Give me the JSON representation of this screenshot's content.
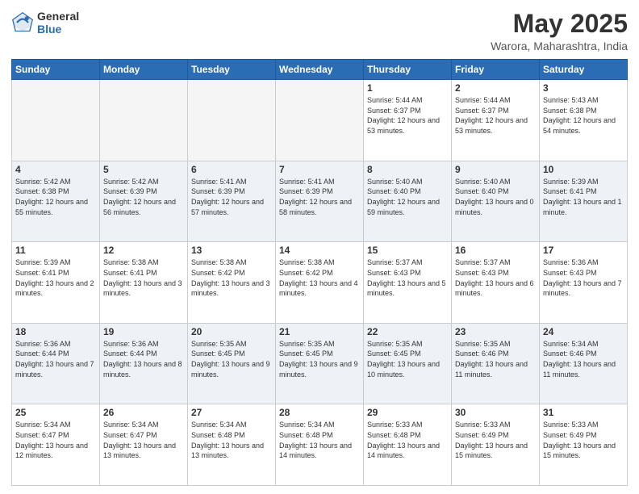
{
  "header": {
    "logo_general": "General",
    "logo_blue": "Blue",
    "month_title": "May 2025",
    "location": "Warora, Maharashtra, India"
  },
  "days_of_week": [
    "Sunday",
    "Monday",
    "Tuesday",
    "Wednesday",
    "Thursday",
    "Friday",
    "Saturday"
  ],
  "weeks": [
    [
      {
        "day": "",
        "empty": true
      },
      {
        "day": "",
        "empty": true
      },
      {
        "day": "",
        "empty": true
      },
      {
        "day": "",
        "empty": true
      },
      {
        "day": "1",
        "sunrise": "5:44 AM",
        "sunset": "6:37 PM",
        "daylight": "12 hours and 53 minutes."
      },
      {
        "day": "2",
        "sunrise": "5:44 AM",
        "sunset": "6:37 PM",
        "daylight": "12 hours and 53 minutes."
      },
      {
        "day": "3",
        "sunrise": "5:43 AM",
        "sunset": "6:38 PM",
        "daylight": "12 hours and 54 minutes."
      }
    ],
    [
      {
        "day": "4",
        "sunrise": "5:42 AM",
        "sunset": "6:38 PM",
        "daylight": "12 hours and 55 minutes."
      },
      {
        "day": "5",
        "sunrise": "5:42 AM",
        "sunset": "6:39 PM",
        "daylight": "12 hours and 56 minutes."
      },
      {
        "day": "6",
        "sunrise": "5:41 AM",
        "sunset": "6:39 PM",
        "daylight": "12 hours and 57 minutes."
      },
      {
        "day": "7",
        "sunrise": "5:41 AM",
        "sunset": "6:39 PM",
        "daylight": "12 hours and 58 minutes."
      },
      {
        "day": "8",
        "sunrise": "5:40 AM",
        "sunset": "6:40 PM",
        "daylight": "12 hours and 59 minutes."
      },
      {
        "day": "9",
        "sunrise": "5:40 AM",
        "sunset": "6:40 PM",
        "daylight": "13 hours and 0 minutes."
      },
      {
        "day": "10",
        "sunrise": "5:39 AM",
        "sunset": "6:41 PM",
        "daylight": "13 hours and 1 minute."
      }
    ],
    [
      {
        "day": "11",
        "sunrise": "5:39 AM",
        "sunset": "6:41 PM",
        "daylight": "13 hours and 2 minutes."
      },
      {
        "day": "12",
        "sunrise": "5:38 AM",
        "sunset": "6:41 PM",
        "daylight": "13 hours and 3 minutes."
      },
      {
        "day": "13",
        "sunrise": "5:38 AM",
        "sunset": "6:42 PM",
        "daylight": "13 hours and 3 minutes."
      },
      {
        "day": "14",
        "sunrise": "5:38 AM",
        "sunset": "6:42 PM",
        "daylight": "13 hours and 4 minutes."
      },
      {
        "day": "15",
        "sunrise": "5:37 AM",
        "sunset": "6:43 PM",
        "daylight": "13 hours and 5 minutes."
      },
      {
        "day": "16",
        "sunrise": "5:37 AM",
        "sunset": "6:43 PM",
        "daylight": "13 hours and 6 minutes."
      },
      {
        "day": "17",
        "sunrise": "5:36 AM",
        "sunset": "6:43 PM",
        "daylight": "13 hours and 7 minutes."
      }
    ],
    [
      {
        "day": "18",
        "sunrise": "5:36 AM",
        "sunset": "6:44 PM",
        "daylight": "13 hours and 7 minutes."
      },
      {
        "day": "19",
        "sunrise": "5:36 AM",
        "sunset": "6:44 PM",
        "daylight": "13 hours and 8 minutes."
      },
      {
        "day": "20",
        "sunrise": "5:35 AM",
        "sunset": "6:45 PM",
        "daylight": "13 hours and 9 minutes."
      },
      {
        "day": "21",
        "sunrise": "5:35 AM",
        "sunset": "6:45 PM",
        "daylight": "13 hours and 9 minutes."
      },
      {
        "day": "22",
        "sunrise": "5:35 AM",
        "sunset": "6:45 PM",
        "daylight": "13 hours and 10 minutes."
      },
      {
        "day": "23",
        "sunrise": "5:35 AM",
        "sunset": "6:46 PM",
        "daylight": "13 hours and 11 minutes."
      },
      {
        "day": "24",
        "sunrise": "5:34 AM",
        "sunset": "6:46 PM",
        "daylight": "13 hours and 11 minutes."
      }
    ],
    [
      {
        "day": "25",
        "sunrise": "5:34 AM",
        "sunset": "6:47 PM",
        "daylight": "13 hours and 12 minutes."
      },
      {
        "day": "26",
        "sunrise": "5:34 AM",
        "sunset": "6:47 PM",
        "daylight": "13 hours and 13 minutes."
      },
      {
        "day": "27",
        "sunrise": "5:34 AM",
        "sunset": "6:48 PM",
        "daylight": "13 hours and 13 minutes."
      },
      {
        "day": "28",
        "sunrise": "5:34 AM",
        "sunset": "6:48 PM",
        "daylight": "13 hours and 14 minutes."
      },
      {
        "day": "29",
        "sunrise": "5:33 AM",
        "sunset": "6:48 PM",
        "daylight": "13 hours and 14 minutes."
      },
      {
        "day": "30",
        "sunrise": "5:33 AM",
        "sunset": "6:49 PM",
        "daylight": "13 hours and 15 minutes."
      },
      {
        "day": "31",
        "sunrise": "5:33 AM",
        "sunset": "6:49 PM",
        "daylight": "13 hours and 15 minutes."
      }
    ]
  ],
  "labels": {
    "sunrise": "Sunrise:",
    "sunset": "Sunset:",
    "daylight": "Daylight:"
  }
}
